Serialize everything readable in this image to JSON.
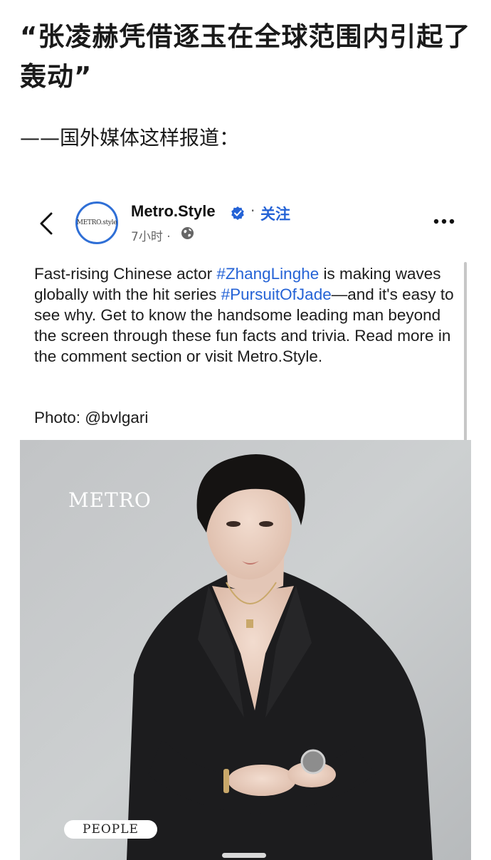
{
  "article": {
    "headline": "“张凌赫凭借逐玉在全球范围内引起了轰动”",
    "subline": "——国外媒体这样报道："
  },
  "post": {
    "avatar_text": "METRO.style",
    "page_name": "Metro.Style",
    "separator": "·",
    "follow_label": "关注",
    "time": "7小时 ·",
    "text_1": "Fast-rising Chinese actor ",
    "tag_1": "#ZhangLinghe",
    "text_2": " is making waves globally with the hit series ",
    "tag_2": "#PursuitOfJade",
    "text_3": "—and it's easy to see why. Get to know the handsome leading man beyond the screen through these fun facts and trivia. Read more in the comment section or visit Metro.Style.",
    "photo_credit": "Photo: @bvlgari",
    "image_logo": "METRO",
    "image_badge": "PEOPLE"
  },
  "icons": {
    "back": "chevron-left-icon",
    "verified": "verified-badge-icon",
    "audience": "globe-icon",
    "more": "more-dots-icon"
  },
  "colors": {
    "link": "#2563d6",
    "avatar_ring": "#2f6fd6",
    "photo_bg": "#c9cbcc"
  }
}
